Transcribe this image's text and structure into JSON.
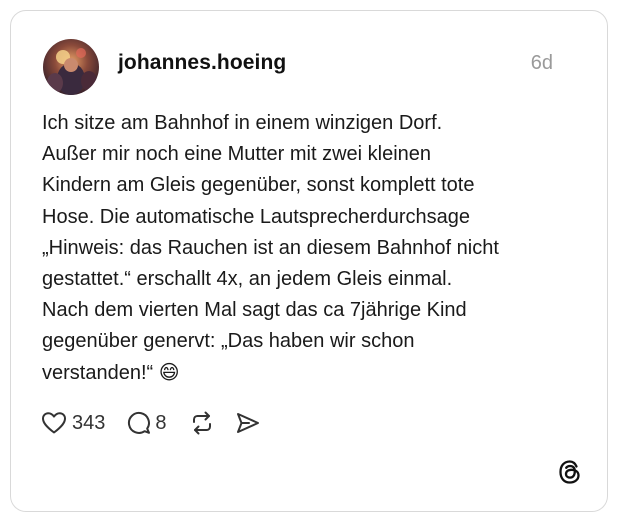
{
  "post": {
    "username": "johannes.hoeing",
    "age": "6d",
    "text": "Ich sitze am Bahnhof in einem winzigen Dorf.\nAußer mir noch eine Mutter mit zwei kleinen\nKindern am Gleis gegenüber, sonst komplett tote\nHose. Die automatische Lautsprecherdurchsage\n„Hinweis: das Rauchen ist an diesem Bahnhof nicht\ngestattet.“ erschallt 4x, an jedem Gleis einmal.\nNach dem vierten Mal sagt das ca 7jährige Kind\ngegenüber genervt: „Das haben wir schon\nverstanden!“ 😄",
    "likes": "343",
    "replies": "8"
  },
  "icons": {
    "like": "heart-icon",
    "reply": "speech-bubble-icon",
    "repost": "repost-icon",
    "share": "send-icon",
    "brand": "threads-logo-icon"
  },
  "colors": {
    "text": "#1a1a1a",
    "muted": "#9a9a9a",
    "border": "#d9d9d9"
  }
}
